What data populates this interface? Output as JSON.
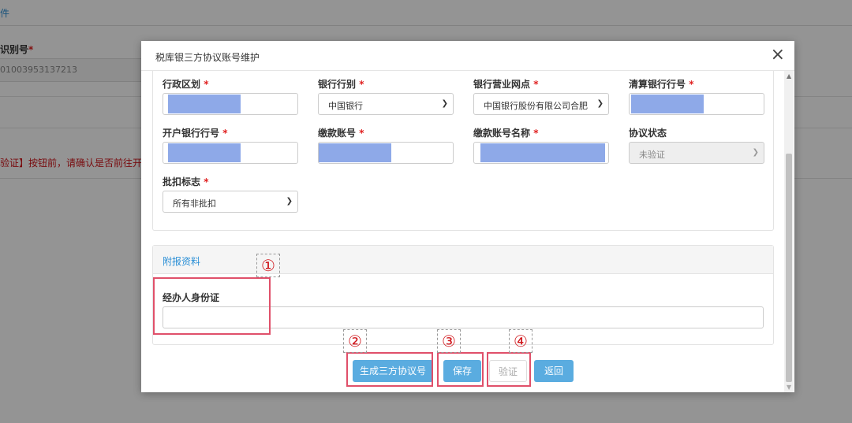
{
  "background": {
    "tab_label": "件",
    "id_label": "识别号",
    "id_value": "01003953137213",
    "warning_text": "验证】按钮前，请确认是否前往开户"
  },
  "modal": {
    "title": "税库银三方协议账号维护",
    "close_symbol": "×",
    "fields": {
      "admin_region": {
        "label": "行政区划",
        "value": ""
      },
      "bank_type": {
        "label": "银行行别",
        "value": "中国银行"
      },
      "bank_branch": {
        "label": "银行营业网点",
        "value": "中国银行股份有限公司合肥"
      },
      "clearing_bank_no": {
        "label": "清算银行行号",
        "value": ""
      },
      "open_bank_no": {
        "label": "开户银行行号",
        "value": ""
      },
      "payment_account": {
        "label": "缴款账号",
        "value": ""
      },
      "payment_account_name": {
        "label": "缴款账号名称",
        "value": ""
      },
      "agreement_status": {
        "label": "协议状态",
        "value": "未验证"
      },
      "deduction_flag": {
        "label": "批扣标志",
        "value": "所有非批扣"
      }
    },
    "required_mark": "*",
    "attachment": {
      "title": "附报资料",
      "id_card_label": "经办人身份证",
      "id_card_value": ""
    },
    "buttons": {
      "generate": "生成三方协议号",
      "save": "保存",
      "verify": "验证",
      "back": "返回"
    },
    "annotations": [
      "①",
      "②",
      "③",
      "④"
    ]
  },
  "colors": {
    "accent": "#2a8fd6",
    "button_primary": "#5aace0",
    "required": "#e02020",
    "highlight": "#e0506a",
    "mask": "#8ea9e8"
  }
}
